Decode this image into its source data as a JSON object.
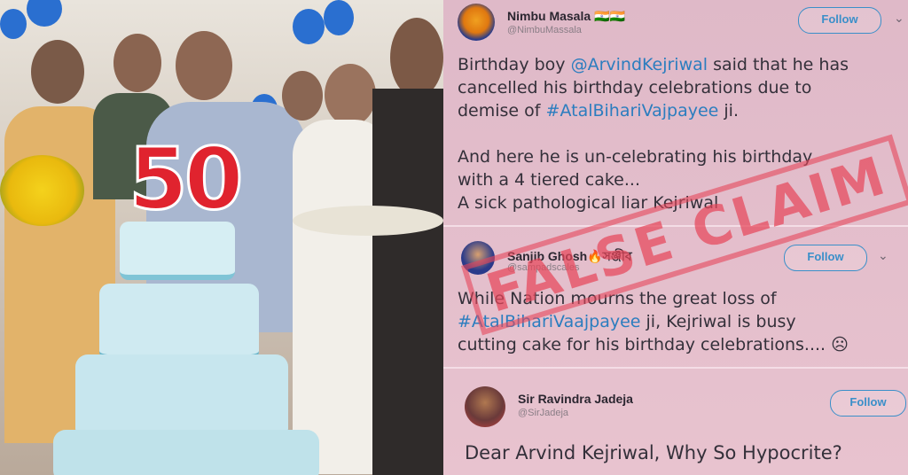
{
  "photo": {
    "cake_number": "50"
  },
  "tweets": [
    {
      "name": "Nimbu Masala 🇮🇳🇮🇳",
      "handle": "@NimbuMassala",
      "follow": "Follow",
      "chevron": "⌄",
      "lines": [
        {
          "parts": [
            "Birthday boy ",
            "@ArvindKejriwal",
            " said that he has"
          ]
        },
        {
          "parts": [
            "cancelled his birthday celebrations due to"
          ]
        },
        {
          "parts": [
            "demise of ",
            "#AtalBihariVajpayee",
            " ji."
          ]
        },
        {
          "parts": [
            ""
          ]
        },
        {
          "parts": [
            "And here he is un-celebrating his birthday"
          ]
        },
        {
          "parts": [
            "with a 4 tiered cake..."
          ]
        },
        {
          "parts": [
            "A sick pathological liar Kejriwal"
          ]
        }
      ]
    },
    {
      "name": "Sanjib Ghosh🔥সঞ্জীব",
      "handle": "@sampadscales",
      "follow": "Follow",
      "chevron": "⌄",
      "lines": [
        {
          "parts": [
            "While Nation mourns the great loss of"
          ]
        },
        {
          "parts": [
            "#AtalBihariVaajpayee",
            " ji, Kejriwal is busy"
          ]
        },
        {
          "parts": [
            "cutting cake for his birthday celebrations.... ☹"
          ]
        }
      ]
    },
    {
      "name": "Sir Ravindra Jadeja",
      "handle": "@SirJadeja",
      "follow": "Follow",
      "lines": [
        {
          "parts": [
            "Dear Arvind Kejriwal, Why So Hypocrite?"
          ]
        }
      ]
    }
  ],
  "stamp": "FALSE CLAIM",
  "colors": {
    "link": "#2b7dbf",
    "stamp": "#e6465a",
    "follow": "#3a8fc9"
  }
}
